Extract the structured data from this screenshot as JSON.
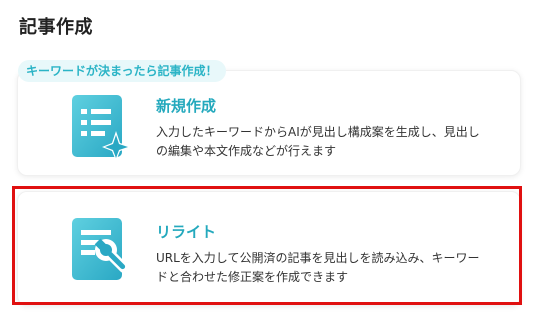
{
  "section": {
    "title": "記事作成"
  },
  "tag": {
    "label": "キーワードが決まったら記事作成！"
  },
  "cards": [
    {
      "title": "新規作成",
      "description": "入力したキーワードからAIが見出し構成案を生成し、見出しの編集や本文作成などが行えます",
      "icon": "document-sparkle-icon",
      "selected": false
    },
    {
      "title": "リライト",
      "description": "URLを入力して公開済の記事を見出しを読み込み、キーワードと合わせた修正案を作成できます",
      "icon": "document-wrench-icon",
      "selected": true
    }
  ],
  "colors": {
    "accent": "#24a9bd",
    "tag_background": "#e8f8fa",
    "highlight": "#e01010"
  }
}
